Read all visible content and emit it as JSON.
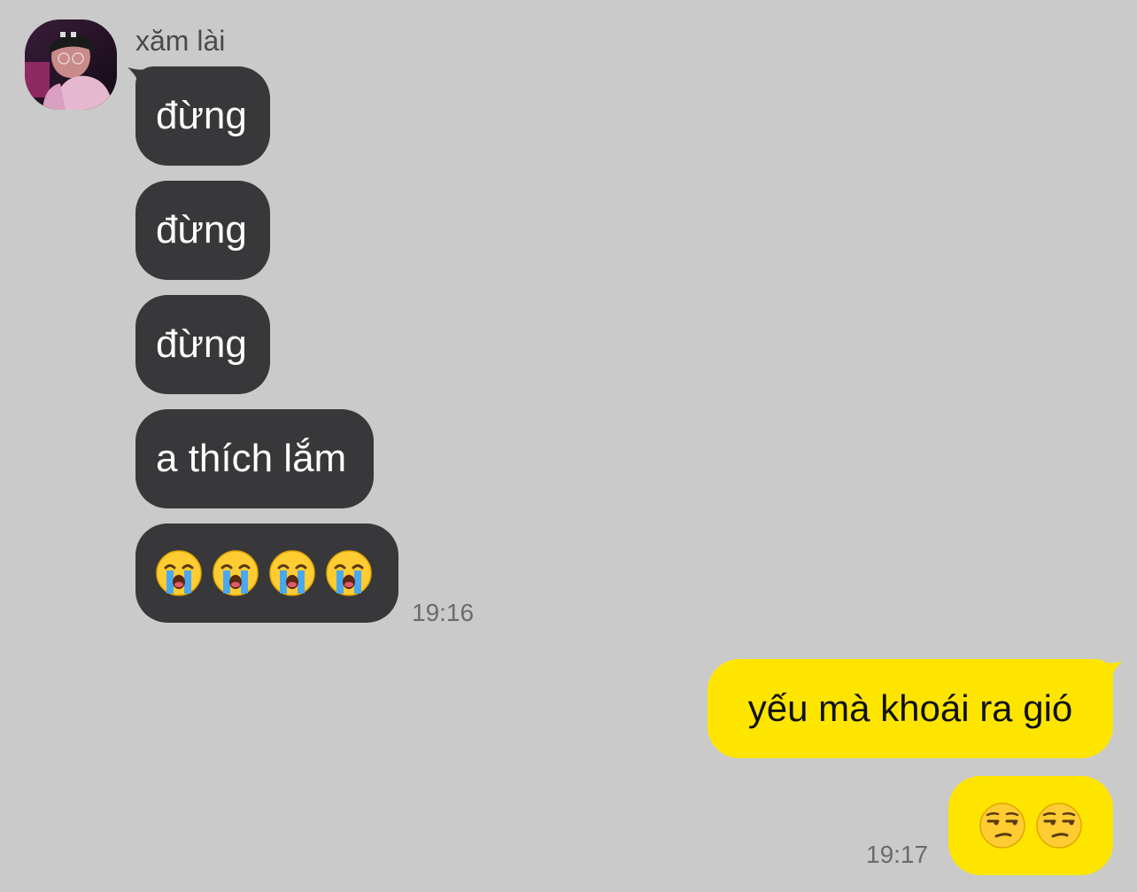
{
  "contact": {
    "name": "xăm lài",
    "avatar_icon": "profile-avatar"
  },
  "incoming": {
    "messages": [
      "đừng",
      "đừng",
      "đừng",
      "a thích lắm"
    ],
    "emoji_message": {
      "emoji": "loudly-crying-face",
      "count": 4
    },
    "time": "19:16"
  },
  "outgoing": {
    "message": "yếu mà khoái ra gió",
    "emoji_message": {
      "emoji": "unamused-face",
      "count": 2
    },
    "time": "19:17"
  },
  "colors": {
    "background": "#cacaca",
    "incoming_bubble": "#38383a",
    "outgoing_bubble": "#fee500"
  }
}
